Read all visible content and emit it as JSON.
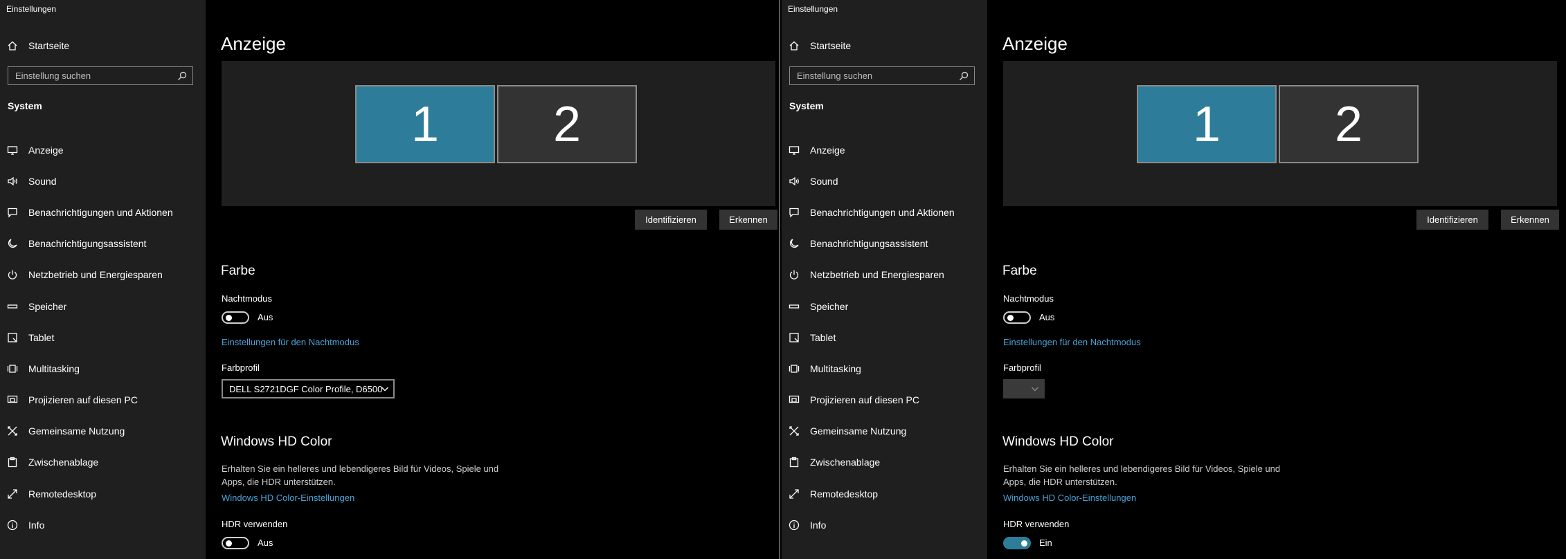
{
  "panels": [
    {
      "app_title": "Einstellungen",
      "home_label": "Startseite",
      "search_placeholder": "Einstellung suchen",
      "section": "System",
      "nav": [
        {
          "label": "Anzeige",
          "icon": "monitor-icon"
        },
        {
          "label": "Sound",
          "icon": "speaker-icon"
        },
        {
          "label": "Benachrichtigungen und Aktionen",
          "icon": "message-icon"
        },
        {
          "label": "Benachrichtigungsassistent",
          "icon": "moon-icon"
        },
        {
          "label": "Netzbetrieb und Energiesparen",
          "icon": "power-icon"
        },
        {
          "label": "Speicher",
          "icon": "storage-icon"
        },
        {
          "label": "Tablet",
          "icon": "tablet-icon"
        },
        {
          "label": "Multitasking",
          "icon": "multitasking-icon"
        },
        {
          "label": "Projizieren auf diesen PC",
          "icon": "project-icon"
        },
        {
          "label": "Gemeinsame Nutzung",
          "icon": "share-icon"
        },
        {
          "label": "Zwischenablage",
          "icon": "clipboard-icon"
        },
        {
          "label": "Remotedesktop",
          "icon": "remote-icon"
        },
        {
          "label": "Info",
          "icon": "info-icon"
        }
      ],
      "page_title": "Anzeige",
      "monitor1": "1",
      "monitor2": "2",
      "identify": "Identifizieren",
      "detect": "Erkennen",
      "color_heading": "Farbe",
      "night_mode_label": "Nachtmodus",
      "night_mode_state": "Aus",
      "night_mode_link": "Einstellungen für den Nachtmodus",
      "profile_label": "Farbprofil",
      "profile_value": "DELL S2721DGF Color Profile, D6500",
      "hd_heading": "Windows HD Color",
      "hd_desc": "Erhalten Sie ein helleres und lebendigeres Bild für Videos, Spiele und Apps, die HDR unterstützen.",
      "hd_link": "Windows HD Color-Einstellungen",
      "hdr_label": "HDR verwenden",
      "hdr_state": "Aus"
    },
    {
      "app_title": "Einstellungen",
      "home_label": "Startseite",
      "search_placeholder": "Einstellung suchen",
      "section": "System",
      "nav": [
        {
          "label": "Anzeige",
          "icon": "monitor-icon"
        },
        {
          "label": "Sound",
          "icon": "speaker-icon"
        },
        {
          "label": "Benachrichtigungen und Aktionen",
          "icon": "message-icon"
        },
        {
          "label": "Benachrichtigungsassistent",
          "icon": "moon-icon"
        },
        {
          "label": "Netzbetrieb und Energiesparen",
          "icon": "power-icon"
        },
        {
          "label": "Speicher",
          "icon": "storage-icon"
        },
        {
          "label": "Tablet",
          "icon": "tablet-icon"
        },
        {
          "label": "Multitasking",
          "icon": "multitasking-icon"
        },
        {
          "label": "Projizieren auf diesen PC",
          "icon": "project-icon"
        },
        {
          "label": "Gemeinsame Nutzung",
          "icon": "share-icon"
        },
        {
          "label": "Zwischenablage",
          "icon": "clipboard-icon"
        },
        {
          "label": "Remotedesktop",
          "icon": "remote-icon"
        },
        {
          "label": "Info",
          "icon": "info-icon"
        }
      ],
      "page_title": "Anzeige",
      "monitor1": "1",
      "monitor2": "2",
      "identify": "Identifizieren",
      "detect": "Erkennen",
      "color_heading": "Farbe",
      "night_mode_label": "Nachtmodus",
      "night_mode_state": "Aus",
      "night_mode_link": "Einstellungen für den Nachtmodus",
      "profile_label": "Farbprofil",
      "profile_value": "",
      "hd_heading": "Windows HD Color",
      "hd_desc": "Erhalten Sie ein helleres und lebendigeres Bild für Videos, Spiele und Apps, die HDR unterstützen.",
      "hd_link": "Windows HD Color-Einstellungen",
      "hdr_label": "HDR verwenden",
      "hdr_state": "Ein"
    }
  ],
  "colors": {
    "accent": "#2d7d9a",
    "link": "#4aa3d8",
    "sidebar_bg": "#1f1f1f"
  }
}
